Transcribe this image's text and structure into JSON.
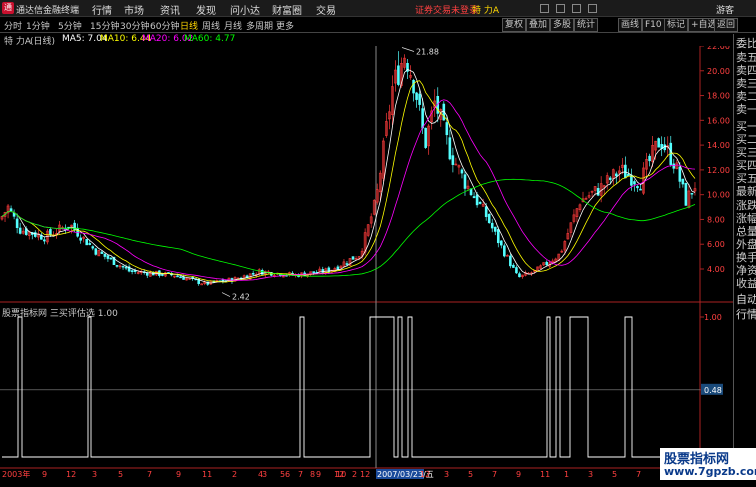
{
  "app": {
    "name": "通达信金融终端",
    "menu": [
      "行情",
      "市场",
      "资讯",
      "发现",
      "问小达",
      "财富圈",
      "交易"
    ],
    "trade_status": "证券交易未登录",
    "stock_name": "特 力A",
    "guest": "游客"
  },
  "periods": [
    "分时",
    "1分钟",
    "5分钟",
    "15分钟",
    "30分钟",
    "60分钟",
    "日线",
    "周线",
    "月线",
    "多周期",
    "更多"
  ],
  "active_period": "日线",
  "tools": [
    "复权",
    "叠加",
    "多股",
    "统计",
    "画线",
    "F10",
    "标记",
    "+自选",
    "返回"
  ],
  "info": {
    "stock": "特 力A",
    "period": "(日线)",
    "ma5": "MA5: 7.04",
    "ma10": "MA10: 6.44",
    "ma20": "MA20: 6.02",
    "ma60": "MA60: 4.77"
  },
  "price_axis": [
    "22.00",
    "20.00",
    "18.00",
    "16.00",
    "14.00",
    "12.00",
    "10.00",
    "8.00",
    "6.00",
    "4.00"
  ],
  "annotations": {
    "high": "21.88",
    "low": "2.42"
  },
  "indicator": {
    "source": "股票指标网",
    "name": "三买评估选",
    "value": "1.00",
    "axis": [
      "1.00",
      "0.48",
      "0.00"
    ],
    "current_value_label": "0.48"
  },
  "side_panel": [
    "委比",
    "卖五",
    "卖四",
    "卖三",
    "卖二",
    "卖一",
    "买一",
    "买二",
    "买三",
    "买四",
    "买五",
    "最新",
    "涨跌",
    "涨幅",
    "总量",
    "外盘",
    "换手",
    "净资",
    "收益",
    "自动",
    "行情"
  ],
  "time_axis": [
    "2003年",
    "9",
    "12",
    "3",
    "5",
    "7",
    "9",
    "11",
    "2",
    "4",
    "6",
    "8",
    "10",
    "12",
    "3",
    "5",
    "7",
    "9",
    "12",
    "2",
    "2007/03/23/五",
    "12",
    "3",
    "5",
    "7",
    "9",
    "11",
    "1",
    "3",
    "5",
    "7",
    "9",
    "12",
    "3",
    "5"
  ],
  "watermark": {
    "text": "股票指标网",
    "url": "www.7gpzb.com"
  },
  "colors": {
    "up": "#ff3c3c",
    "down": "#54ffff",
    "ma5": "#ffffff",
    "ma10": "#ffff00",
    "ma20": "#ff00ff",
    "ma60": "#00ff00",
    "indicator": "#ffffff"
  }
}
